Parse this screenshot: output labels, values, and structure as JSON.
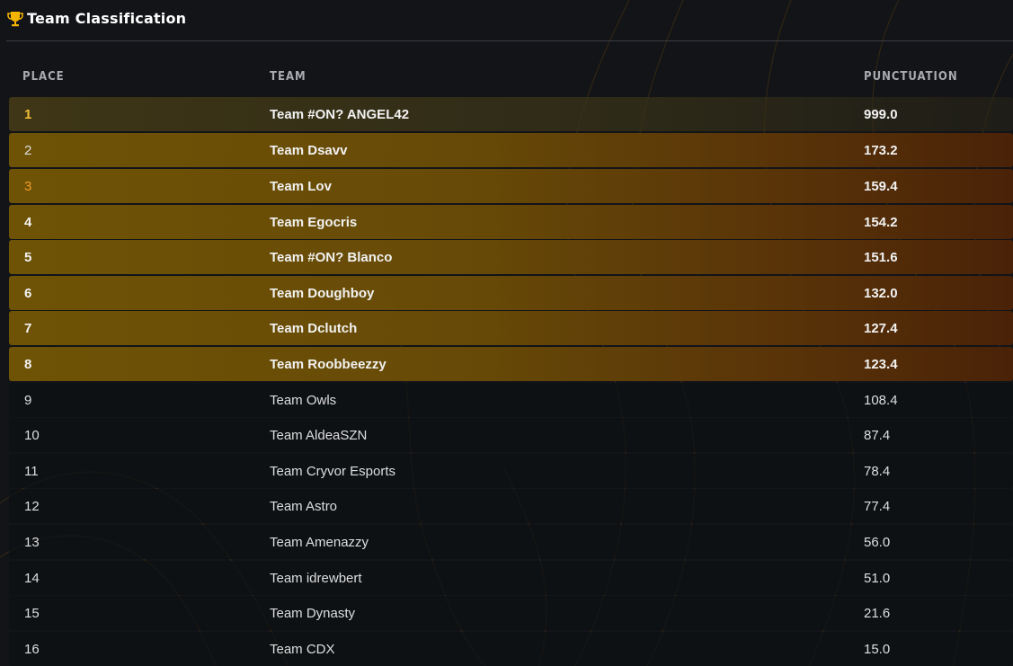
{
  "header": {
    "title": "Team Classification",
    "icon": "trophy-icon"
  },
  "columns": {
    "place": "PLACE",
    "team": "TEAM",
    "points": "PUNCTUATION"
  },
  "colors": {
    "accent_gold": "#f4c038",
    "accent_orange": "#f19a2a",
    "highlight_bg": "#6e5306",
    "background": "#121418"
  },
  "rows": [
    {
      "place": "1",
      "team": "Team #ON? ANGEL42",
      "points": "999.0"
    },
    {
      "place": "2",
      "team": "Team Dsavv",
      "points": "173.2"
    },
    {
      "place": "3",
      "team": "Team Lov",
      "points": "159.4"
    },
    {
      "place": "4",
      "team": "Team Egocris",
      "points": "154.2"
    },
    {
      "place": "5",
      "team": "Team #ON? Blanco",
      "points": "151.6"
    },
    {
      "place": "6",
      "team": "Team Doughboy",
      "points": "132.0"
    },
    {
      "place": "7",
      "team": "Team Dclutch",
      "points": "127.4"
    },
    {
      "place": "8",
      "team": "Team Roobbeezzy",
      "points": "123.4"
    },
    {
      "place": "9",
      "team": "Team Owls",
      "points": "108.4"
    },
    {
      "place": "10",
      "team": "Team AldeaSZN",
      "points": "87.4"
    },
    {
      "place": "11",
      "team": "Team Cryvor Esports",
      "points": "78.4"
    },
    {
      "place": "12",
      "team": "Team Astro",
      "points": "77.4"
    },
    {
      "place": "13",
      "team": "Team Amenazzy",
      "points": "56.0"
    },
    {
      "place": "14",
      "team": "Team idrewbert",
      "points": "51.0"
    },
    {
      "place": "15",
      "team": "Team Dynasty",
      "points": "21.6"
    },
    {
      "place": "16",
      "team": "Team CDX",
      "points": "15.0"
    }
  ]
}
